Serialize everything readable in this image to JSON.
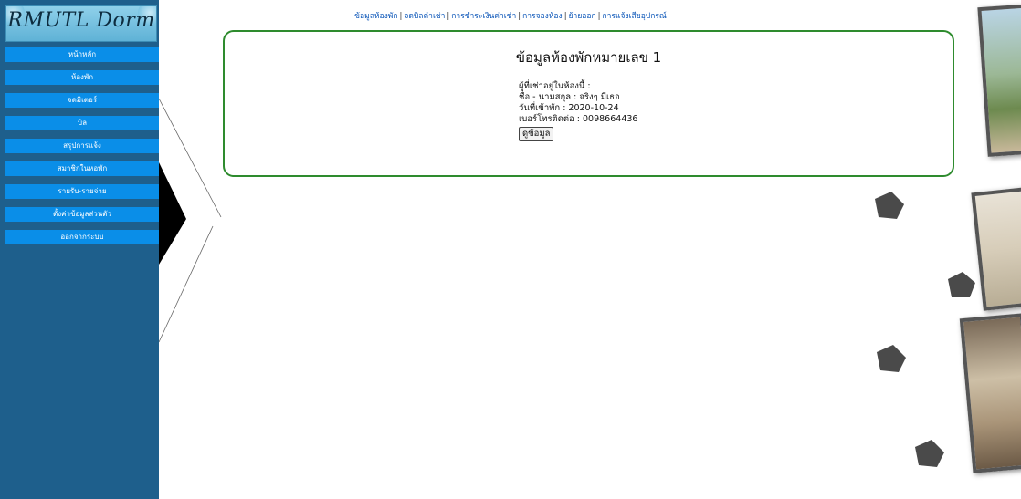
{
  "logo": {
    "text": "RMUTL Dorm"
  },
  "sidebar": {
    "items": [
      {
        "label": "หน้าหลัก"
      },
      {
        "label": "ห้องพัก"
      },
      {
        "label": "จดมิเตอร์"
      },
      {
        "label": "บิล"
      },
      {
        "label": "สรุปการแจ้ง"
      },
      {
        "label": "สมาชิกในหอพัก"
      },
      {
        "label": "รายรับ-รายจ่าย"
      },
      {
        "label": "ตั้งค่าข้อมูลส่วนตัว"
      },
      {
        "label": "ออกจากระบบ"
      }
    ]
  },
  "toplinks": [
    {
      "label": "ข้อมูลห้องพัก"
    },
    {
      "label": "จดบิลค่าเช่า"
    },
    {
      "label": "การชำระเงินค่าเช่า"
    },
    {
      "label": "การจองห้อง"
    },
    {
      "label": "ย้ายออก"
    },
    {
      "label": "การแจ้งเสียอุปกรณ์"
    }
  ],
  "room": {
    "title": "ข้อมูลห้องพักหมายเลข 1",
    "tenant_heading": "ผู้ที่เช่าอยู่ในห้องนี้ :",
    "name_line": "ชื่อ - นามสกุล : จริงๆ มีเธอ",
    "checkin_line": "วันที่เข้าพัก : 2020-10-24",
    "phone_line": "เบอร์โทรติดต่อ : 0098664436",
    "view_button": "ดูข้อมูล"
  },
  "colors": {
    "sidebar_bg": "#1e5f8c",
    "nav_item_bg": "#0a8ee8",
    "card_border": "#2e8b2e",
    "link": "#0a55b8"
  }
}
